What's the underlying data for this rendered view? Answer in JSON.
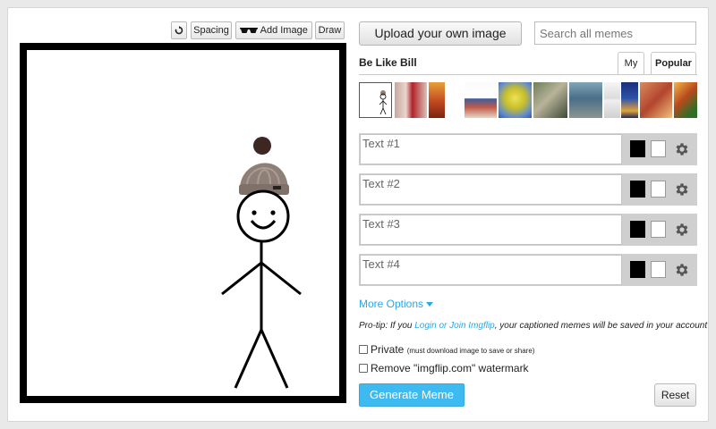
{
  "toolbar": {
    "spacing_label": "Spacing",
    "add_image_label": "Add Image",
    "draw_label": "Draw"
  },
  "upload": {
    "label": "Upload your own image"
  },
  "search": {
    "placeholder": "Search all memes"
  },
  "meme": {
    "title": "Be Like Bill"
  },
  "tabs": {
    "my": "My",
    "popular": "Popular",
    "active": "popular"
  },
  "thumbnails": [
    {
      "name": "be-like-bill",
      "selected": true
    },
    {
      "name": "meme-2"
    },
    {
      "name": "meme-3"
    },
    {
      "name": "meme-4"
    },
    {
      "name": "meme-5"
    },
    {
      "name": "meme-6"
    },
    {
      "name": "meme-7"
    },
    {
      "name": "meme-8"
    },
    {
      "name": "meme-9"
    },
    {
      "name": "meme-10"
    },
    {
      "name": "meme-11"
    },
    {
      "name": "meme-12"
    }
  ],
  "text_boxes": [
    {
      "placeholder": "Text #1",
      "value": ""
    },
    {
      "placeholder": "Text #2",
      "value": ""
    },
    {
      "placeholder": "Text #3",
      "value": ""
    },
    {
      "placeholder": "Text #4",
      "value": ""
    }
  ],
  "more_options": {
    "label": "More Options",
    "icon": "caret-down-icon"
  },
  "protip": {
    "prefix": "Pro-tip: If you",
    "link": "Login or Join Imgflip",
    "suffix": ", your captioned memes will be saved in your account"
  },
  "options": {
    "private_label": "Private",
    "private_note": "(must download image to save or share)",
    "watermark_label": "Remove \"imgflip.com\" watermark"
  },
  "actions": {
    "generate": "Generate Meme",
    "reset": "Reset"
  },
  "colors": {
    "accent": "#3fbaf0",
    "link": "#2aa7e6"
  }
}
